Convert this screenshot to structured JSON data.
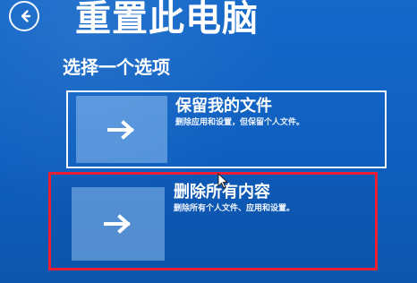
{
  "header": {
    "title": "重置此电脑"
  },
  "section": {
    "label": "选择一个选项"
  },
  "options": [
    {
      "title": "保留我的文件",
      "description": "删除应用和设置，但保留个人文件。"
    },
    {
      "title": "删除所有内容",
      "description": "删除所有个人文件、应用和设置。"
    }
  ],
  "icons": {
    "back": "back-arrow-icon",
    "option": "arrow-right-icon",
    "cursor": "mouse-cursor-icon"
  },
  "colors": {
    "background": "#0f5fc0",
    "tile": "#b5dcff",
    "selection_outline": "#ea1f34"
  }
}
